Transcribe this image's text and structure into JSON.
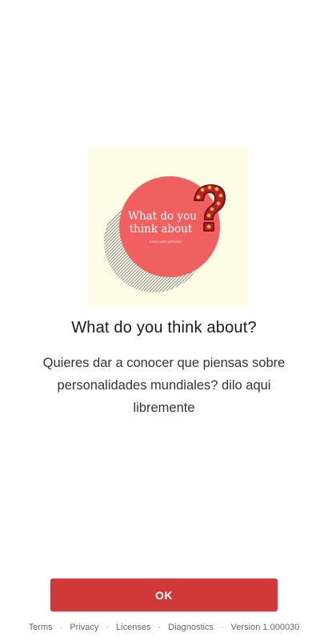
{
  "logo": {
    "line1": "What do you",
    "line2": "think about",
    "tagline": "know your personal",
    "question_mark": "?",
    "colors": {
      "background": "#fdfde6",
      "circle": "#f06060",
      "question_mark": "#b81f2a",
      "question_outline": "#7a0e14",
      "bulbs": "#f5c04a",
      "stripes": "#9a9a9a"
    }
  },
  "title": "What do you think about?",
  "description": "Quieres dar a conocer que piensas sobre personalidades mundiales? dilo aqui libremente",
  "ok_button": {
    "label": "OK",
    "color": "#d13838"
  },
  "footer": {
    "terms": "Terms",
    "privacy": "Privacy",
    "licenses": "Licenses",
    "diagnostics": "Diagnostics",
    "separator": "·",
    "version": "Version 1.000030"
  }
}
